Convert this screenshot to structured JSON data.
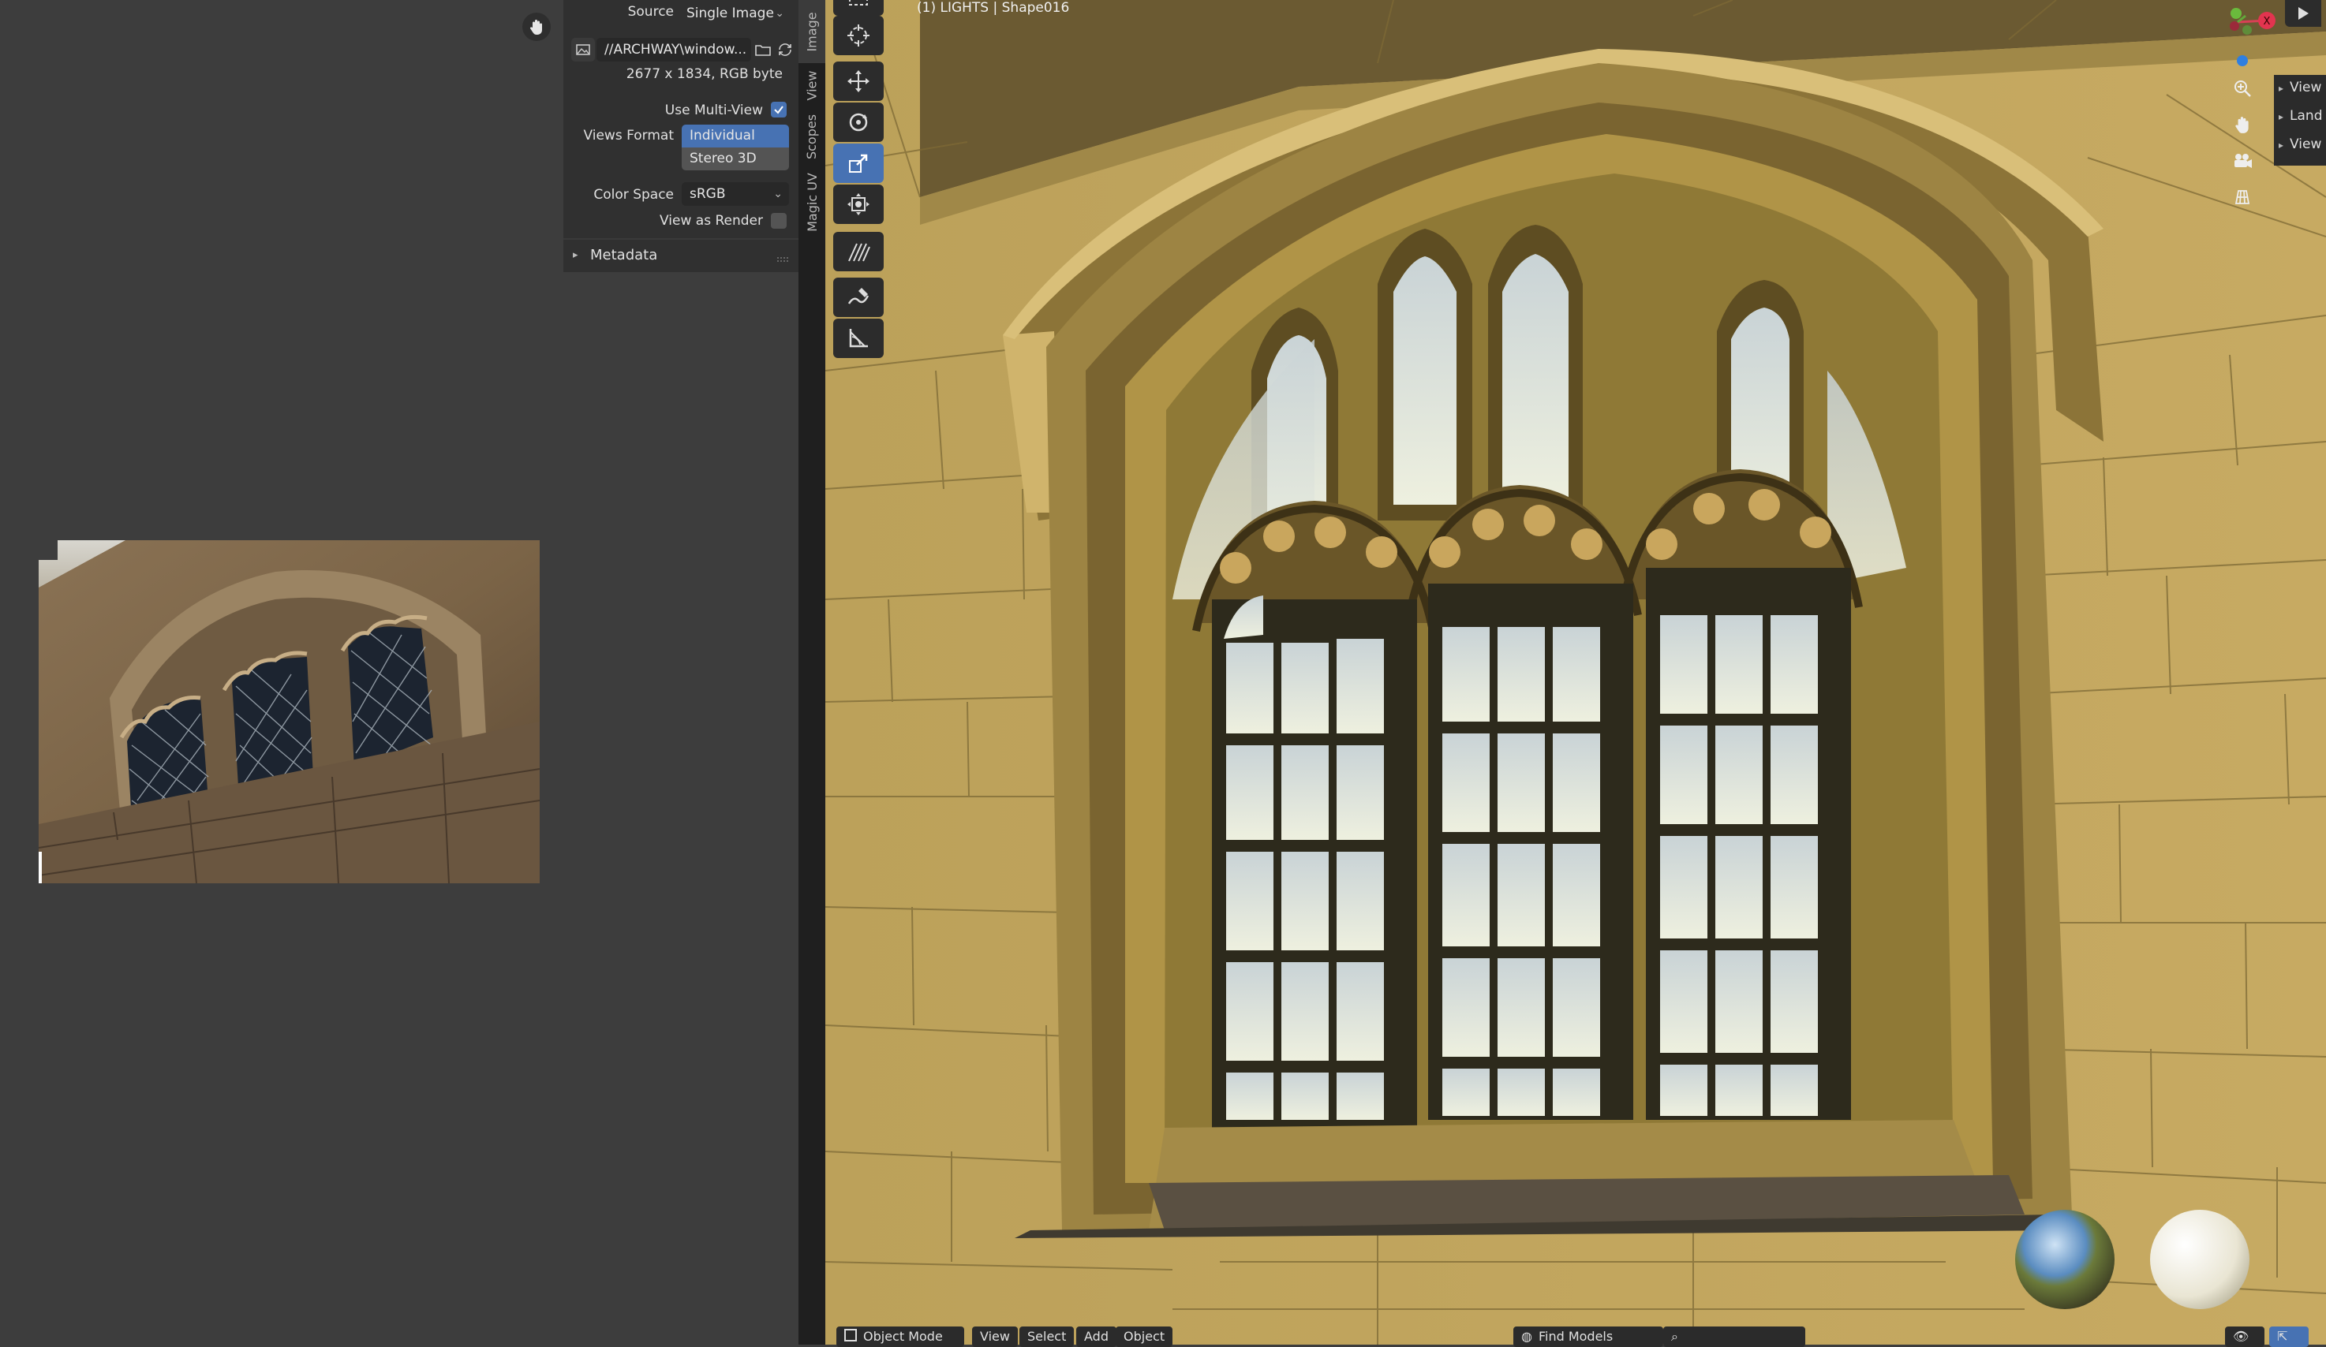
{
  "properties": {
    "source_label": "Source",
    "source_value": "Single Image",
    "filepath": "//ARCHWAY\\window...",
    "image_info": "2677 x 1834,  RGB byte",
    "use_multiview_label": "Use Multi-View",
    "use_multiview_checked": true,
    "views_format_label": "Views Format",
    "views_format_options": [
      "Individual",
      "Stereo 3D"
    ],
    "views_format_selected": "Individual",
    "color_space_label": "Color Space",
    "color_space_value": "sRGB",
    "view_as_render_label": "View as Render",
    "view_as_render_checked": false,
    "metadata_label": "Metadata"
  },
  "side_tabs": [
    "Image",
    "View",
    "Scopes",
    "Magic UV"
  ],
  "side_tabs_active": "Image",
  "tools": [
    "select-box-icon",
    "cursor-icon",
    "move-icon",
    "rotate-icon",
    "scale-icon",
    "transform-icon",
    "hair-icon",
    "annotate-icon",
    "measure-icon"
  ],
  "tools_active": "scale-icon",
  "viewport": {
    "header_text": "(1) LIGHTS | Shape016",
    "n_panel_items": [
      "View",
      "Land",
      "View"
    ],
    "nav_icons": [
      "zoom-icon",
      "pan-hand-icon",
      "camera-icon",
      "grid-icon"
    ]
  },
  "bottom_bar": {
    "mode": "Object Mode",
    "menus": [
      "View",
      "Select",
      "Add",
      "Object"
    ],
    "search_label": "Find Models"
  },
  "colors": {
    "accent": "#4772b3",
    "panel": "#303030",
    "background": "#3d3d3d",
    "stone": "#b5994e"
  }
}
